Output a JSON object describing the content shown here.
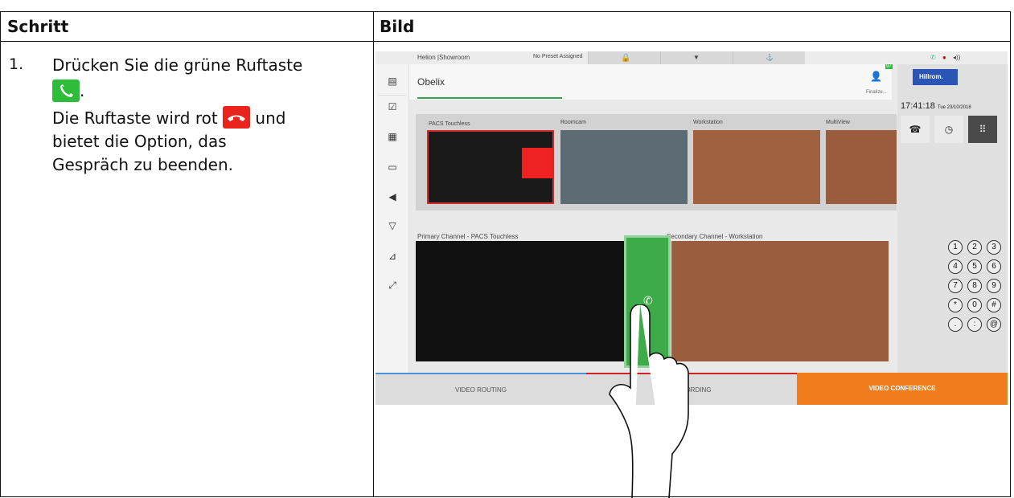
{
  "table": {
    "header_step": "Schritt",
    "header_image": "Bild",
    "step_number": "1.",
    "step_line1": "Drücken Sie die grüne Ruftaste",
    "step_period": ".",
    "step_line2a": "Die Ruftaste wird rot",
    "step_line2b": "und",
    "step_line3": "bietet die Option, das",
    "step_line4": "Gespräch zu beenden."
  },
  "ui": {
    "location": "Helion |Showroom",
    "preset": "No Preset Assigned",
    "patient_name": "Obelix",
    "finalize": "Finalize...",
    "badge": "97",
    "logo_text": "Hillrom.",
    "time": "17:41:18",
    "date": "Tue 23/10/2018",
    "sources": [
      "PACS Touchless",
      "Roomcam",
      "Workstation",
      "MultiView"
    ],
    "primary_channel": "Primary Channel - PACS Touchless",
    "secondary_channel": "Secondary Channel - Workstation",
    "keypad": [
      "1",
      "2",
      "3",
      "4",
      "5",
      "6",
      "7",
      "8",
      "9",
      "*",
      "0",
      "#",
      ".",
      ":",
      "@"
    ],
    "tabs": {
      "video_routing": "VIDEO ROUTING",
      "recording": "RECORDING",
      "video_conference": "VIDEO CONFERENCE"
    },
    "colors": {
      "call_green": "#2ebd3a",
      "hangup_red": "#e8241c",
      "accent_orange": "#f07c1b",
      "accent_blue": "#2a55b4"
    }
  }
}
